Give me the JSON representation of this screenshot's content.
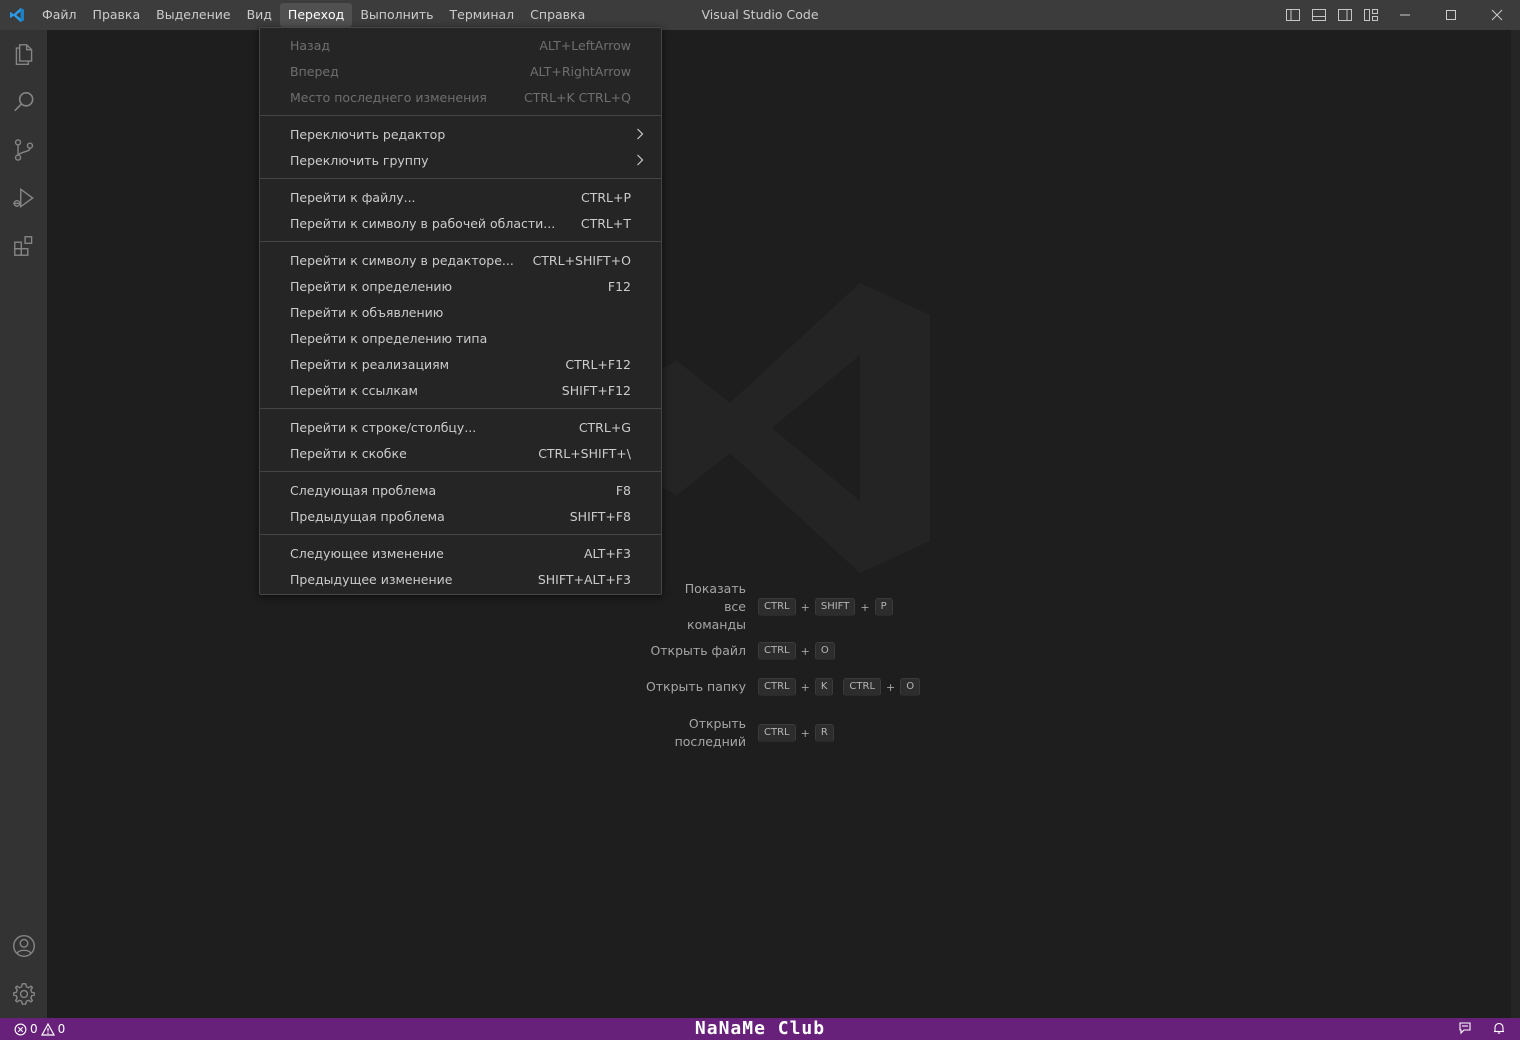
{
  "window": {
    "title": "Visual Studio Code"
  },
  "menubar": {
    "items": [
      {
        "label": "Файл"
      },
      {
        "label": "Правка"
      },
      {
        "label": "Выделение"
      },
      {
        "label": "Вид"
      },
      {
        "label": "Переход",
        "active": true
      },
      {
        "label": "Выполнить"
      },
      {
        "label": "Терминал"
      },
      {
        "label": "Справка"
      }
    ]
  },
  "goto_menu": {
    "groups": [
      [
        {
          "label": "Назад",
          "shortcut": "ALT+LeftArrow",
          "disabled": true
        },
        {
          "label": "Вперед",
          "shortcut": "ALT+RightArrow",
          "disabled": true
        },
        {
          "label": "Место последнего изменения",
          "shortcut": "CTRL+K CTRL+Q",
          "disabled": true
        }
      ],
      [
        {
          "label": "Переключить редактор",
          "shortcut": "",
          "submenu": true
        },
        {
          "label": "Переключить группу",
          "shortcut": "",
          "submenu": true
        }
      ],
      [
        {
          "label": "Перейти к файлу...",
          "shortcut": "CTRL+P"
        },
        {
          "label": "Перейти к символу в рабочей области...",
          "shortcut": "CTRL+T"
        }
      ],
      [
        {
          "label": "Перейти к символу в редакторе...",
          "shortcut": "CTRL+SHIFT+O"
        },
        {
          "label": "Перейти к определению",
          "shortcut": "F12"
        },
        {
          "label": "Перейти к объявлению",
          "shortcut": ""
        },
        {
          "label": "Перейти к определению типа",
          "shortcut": ""
        },
        {
          "label": "Перейти к реализациям",
          "shortcut": "CTRL+F12"
        },
        {
          "label": "Перейти к ссылкам",
          "shortcut": "SHIFT+F12"
        }
      ],
      [
        {
          "label": "Перейти к строке/столбцу...",
          "shortcut": "CTRL+G"
        },
        {
          "label": "Перейти к скобке",
          "shortcut": "CTRL+SHIFT+\\"
        }
      ],
      [
        {
          "label": "Следующая проблема",
          "shortcut": "F8"
        },
        {
          "label": "Предыдущая проблема",
          "shortcut": "SHIFT+F8"
        }
      ],
      [
        {
          "label": "Следующее изменение",
          "shortcut": "ALT+F3"
        },
        {
          "label": "Предыдущее изменение",
          "shortcut": "SHIFT+ALT+F3"
        }
      ]
    ]
  },
  "activitybar": {
    "top": [
      "explorer-icon",
      "search-icon",
      "source-control-icon",
      "run-debug-icon",
      "extensions-icon"
    ],
    "bottom": [
      "account-icon",
      "settings-gear-icon"
    ]
  },
  "welcome_shortcuts": [
    {
      "label": "Показать все команды",
      "keys": [
        [
          "CTRL",
          "SHIFT",
          "P"
        ]
      ]
    },
    {
      "label": "Открыть файл",
      "keys": [
        [
          "CTRL",
          "O"
        ]
      ]
    },
    {
      "label": "Открыть папку",
      "keys": [
        [
          "CTRL",
          "K"
        ],
        [
          "CTRL",
          "O"
        ]
      ]
    },
    {
      "label": "Открыть последний",
      "keys": [
        [
          "CTRL",
          "R"
        ]
      ]
    }
  ],
  "statusbar": {
    "errors": "0",
    "warnings": "0",
    "brand": "NaNaMe Club",
    "color": "#68217a"
  },
  "colors": {
    "accent": "#007acc",
    "menu_bg": "#252526",
    "titlebar": "#3c3c3c"
  }
}
